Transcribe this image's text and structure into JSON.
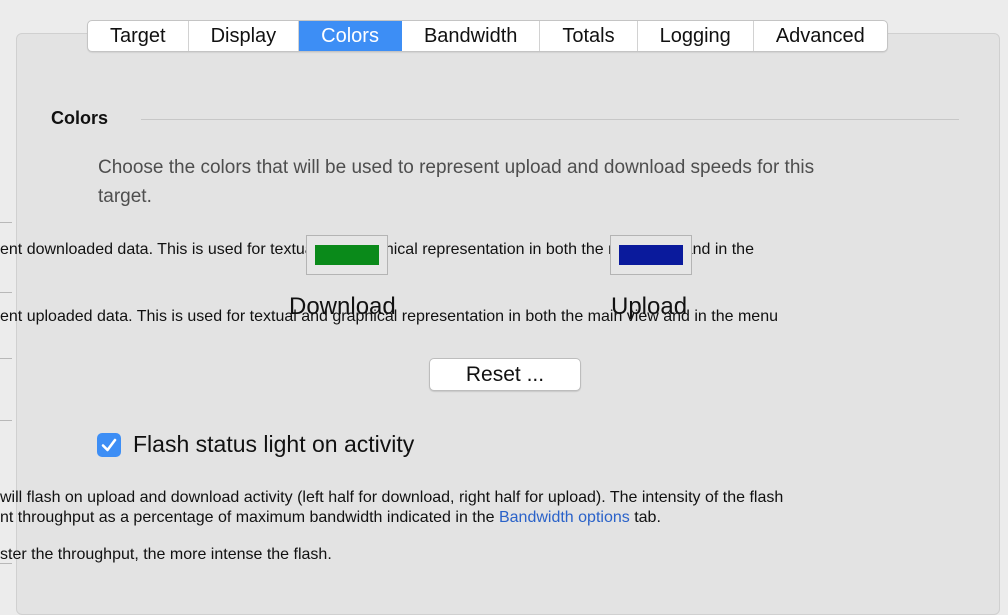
{
  "tabs": [
    {
      "label": "Target",
      "active": false
    },
    {
      "label": "Display",
      "active": false
    },
    {
      "label": "Colors",
      "active": true
    },
    {
      "label": "Bandwidth",
      "active": false
    },
    {
      "label": "Totals",
      "active": false
    },
    {
      "label": "Logging",
      "active": false
    },
    {
      "label": "Advanced",
      "active": false
    }
  ],
  "section": {
    "title": "Colors",
    "description": "Choose the colors that will be used to represent upload and download speeds for this target."
  },
  "download": {
    "label": "Download",
    "color": "#0a8a1a",
    "help": "ent downloaded data. This is used for textual and graphical representation in both the main view and in the"
  },
  "upload": {
    "label": "Upload",
    "color": "#0a1a9c",
    "help": "ent uploaded data. This is used for textual and graphical representation in both the main view and in the menu"
  },
  "reset_label": "Reset ...",
  "flash": {
    "label": "Flash status light on activity",
    "checked": true,
    "info_line1": "will flash on upload and download activity (left half for download, right half for upload). The intensity of the flash",
    "info_line2_pre": "nt throughput as a percentage of maximum bandwidth indicated in the ",
    "info_link": "Bandwidth options",
    "info_line2_post": " tab.",
    "info_line3": "ster the throughput, the more intense the flash."
  },
  "colors": {
    "accent": "#3d8ef5",
    "link": "#2a62c9"
  }
}
